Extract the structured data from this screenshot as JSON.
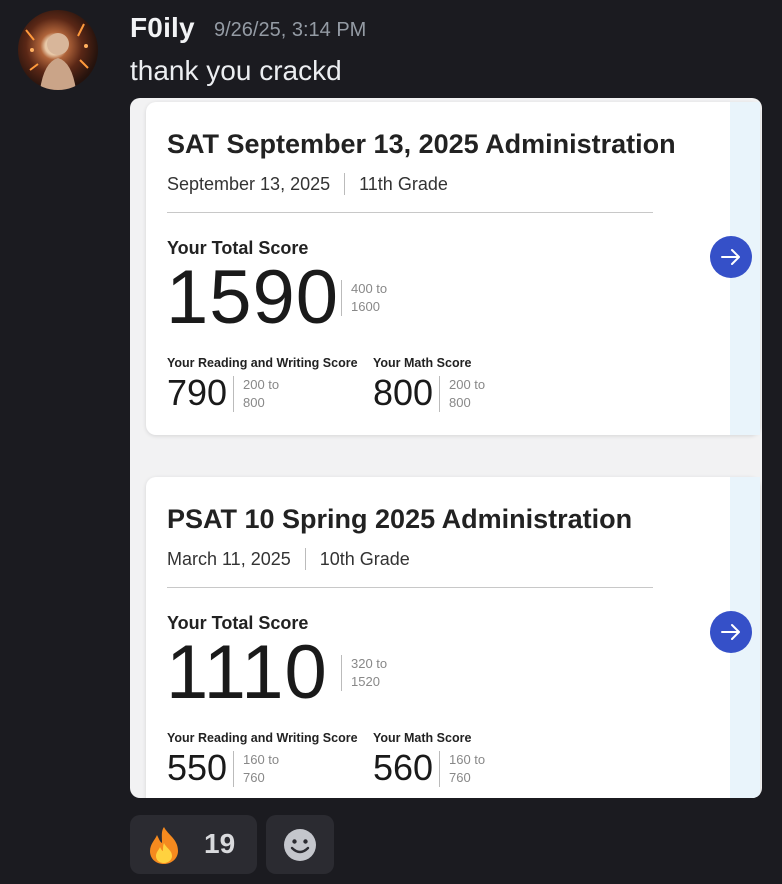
{
  "message": {
    "username": "F0ily",
    "timestamp": "9/26/25, 3:14 PM",
    "text": "thank you crackd"
  },
  "cards": [
    {
      "title": "SAT September 13, 2025 Administration",
      "date": "September 13, 2025",
      "grade": "11th Grade",
      "total_label": "Your Total Score",
      "total_score": "1590",
      "total_range_top": "400 to",
      "total_range_bottom": "1600",
      "rw_label": "Your Reading and Writing Score",
      "rw_score": "790",
      "rw_range_top": "200 to",
      "rw_range_bottom": "800",
      "math_label": "Your Math Score",
      "math_score": "800",
      "math_range_top": "200 to",
      "math_range_bottom": "800"
    },
    {
      "title": "PSAT 10 Spring 2025 Administration",
      "date": "March 11, 2025",
      "grade": "10th Grade",
      "total_label": "Your Total Score",
      "total_score": "1110",
      "total_range_top": "320 to",
      "total_range_bottom": "1520",
      "rw_label": "Your Reading and Writing Score",
      "rw_score": "550",
      "rw_range_top": "160 to",
      "rw_range_bottom": "760",
      "math_label": "Your Math Score",
      "math_score": "560",
      "math_range_top": "160 to",
      "math_range_bottom": "760"
    }
  ],
  "reactions": [
    {
      "icon": "fire-emoji-icon",
      "count": "19"
    },
    {
      "icon": "add-reaction-icon"
    }
  ],
  "colors": {
    "background": "#1b1b20",
    "accent_button": "#3550c8",
    "reaction_bg": "#2b2b31"
  }
}
